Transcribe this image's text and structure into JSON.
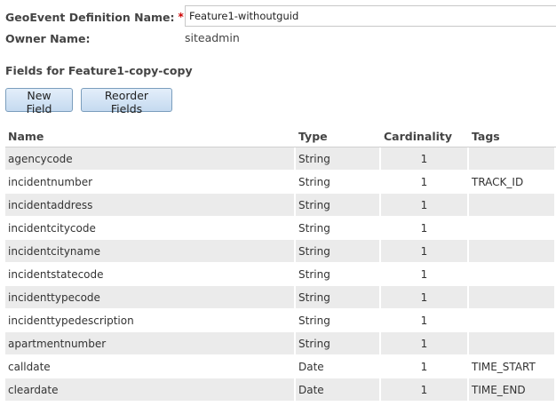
{
  "form": {
    "definition_name_label": "GeoEvent Definition Name:",
    "required_marker": "*",
    "definition_name_value": "Feature1-withoutguid",
    "owner_label": "Owner Name:",
    "owner_value": "siteadmin"
  },
  "fields_section": {
    "heading": "Fields for Feature1-copy-copy",
    "new_field_button": "New Field",
    "reorder_fields_button": "Reorder Fields"
  },
  "table": {
    "columns": [
      "Name",
      "Type",
      "Cardinality",
      "Tags"
    ],
    "rows": [
      {
        "name": "agencycode",
        "type": "String",
        "cardinality": "1",
        "tags": ""
      },
      {
        "name": "incidentnumber",
        "type": "String",
        "cardinality": "1",
        "tags": "TRACK_ID"
      },
      {
        "name": "incidentaddress",
        "type": "String",
        "cardinality": "1",
        "tags": ""
      },
      {
        "name": "incidentcitycode",
        "type": "String",
        "cardinality": "1",
        "tags": ""
      },
      {
        "name": "incidentcityname",
        "type": "String",
        "cardinality": "1",
        "tags": ""
      },
      {
        "name": "incidentstatecode",
        "type": "String",
        "cardinality": "1",
        "tags": ""
      },
      {
        "name": "incidenttypecode",
        "type": "String",
        "cardinality": "1",
        "tags": ""
      },
      {
        "name": "incidenttypedescription",
        "type": "String",
        "cardinality": "1",
        "tags": ""
      },
      {
        "name": "apartmentnumber",
        "type": "String",
        "cardinality": "1",
        "tags": ""
      },
      {
        "name": "calldate",
        "type": "Date",
        "cardinality": "1",
        "tags": "TIME_START"
      },
      {
        "name": "cleardate",
        "type": "Date",
        "cardinality": "1",
        "tags": "TIME_END"
      }
    ]
  },
  "colors": {
    "row_alt_background": "#ebebeb",
    "button_border": "#7b9ebd",
    "button_gradient_top": "#e3eefa",
    "button_gradient_bottom": "#c5daf0",
    "required_marker": "#cc0000"
  }
}
